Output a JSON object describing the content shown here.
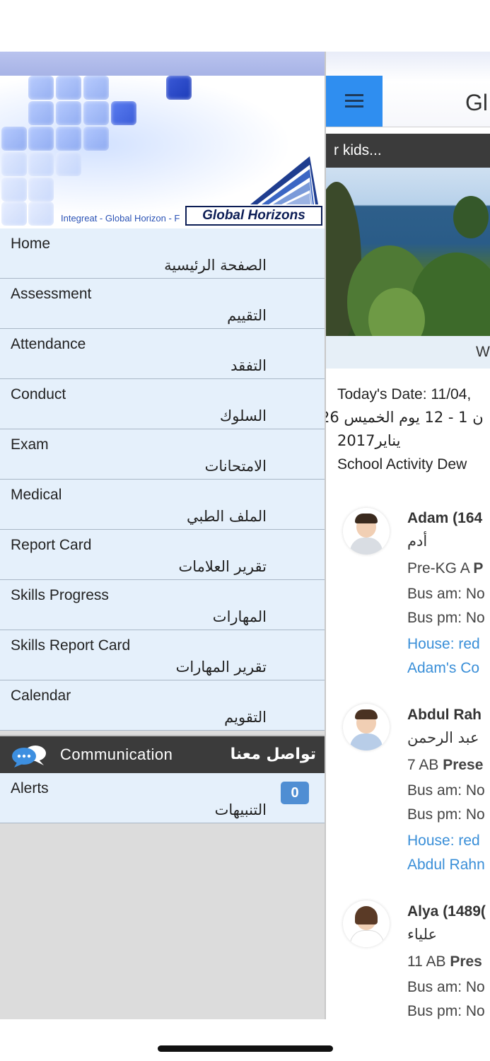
{
  "banner": {
    "caption": "Integreat - Global Horizon - F",
    "brand": "Global Horizons"
  },
  "menu": {
    "items": [
      {
        "en": "Home",
        "ar": "الصفحة الرئيسية"
      },
      {
        "en": "Assessment",
        "ar": "التقييم"
      },
      {
        "en": "Attendance",
        "ar": "التفقد"
      },
      {
        "en": "Conduct",
        "ar": "السلوك"
      },
      {
        "en": "Exam",
        "ar": "الامتحانات"
      },
      {
        "en": "Medical",
        "ar": "الملف الطبي"
      },
      {
        "en": "Report Card",
        "ar": "تقرير العلامات"
      },
      {
        "en": "Skills Progress",
        "ar": "المهارات"
      },
      {
        "en": "Skills Report Card",
        "ar": "تقرير المهارات"
      },
      {
        "en": "Calendar",
        "ar": "التقويم"
      }
    ],
    "communication": {
      "en": "Communication",
      "ar": "تواصل معنا",
      "icon": "chat-bubbles-icon"
    },
    "alerts": {
      "en": "Alerts",
      "ar": "التنبيهات",
      "count": "0"
    }
  },
  "main": {
    "title": "Gl",
    "ticker": "r kids...",
    "welcome": "W",
    "date_lines": [
      "Today's Date: 11/04,",
      "ن 1 - 12 يوم الخميس 26",
      "يناير2017",
      "School Activity Dew"
    ]
  },
  "students": [
    {
      "name": "Adam (164",
      "name_ar": "أدم",
      "class_prefix": "Pre-KG A ",
      "class_status": "P",
      "bus_am": "Bus am: No",
      "bus_pm": "Bus pm: No",
      "house": "House: red",
      "link": "Adam's Co"
    },
    {
      "name": "Abdul Rah",
      "name_ar": "عبد الرحمن",
      "class_prefix": "7 AB ",
      "class_status": "Prese",
      "bus_am": "Bus am: No",
      "bus_pm": "Bus pm: No",
      "house": "House: red",
      "link": "Abdul Rahn"
    },
    {
      "name": "Alya (1489(",
      "name_ar": "علياء",
      "class_prefix": "11 AB ",
      "class_status": "Pres",
      "bus_am": "Bus am: No",
      "bus_pm": "Bus pm: No"
    }
  ]
}
